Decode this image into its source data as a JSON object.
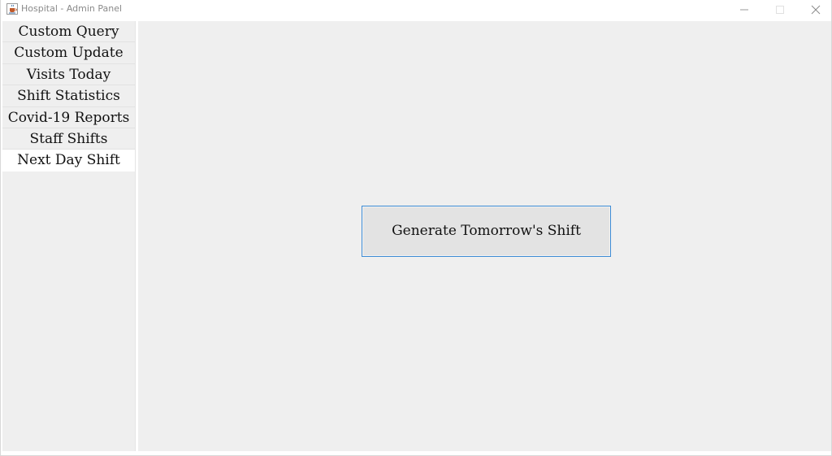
{
  "window": {
    "title": "Hospital - Admin Panel",
    "icon": "java-cup-icon",
    "controls": {
      "minimize": "minimize-icon",
      "maximize": "maximize-icon",
      "close": "close-icon"
    }
  },
  "sidebar": {
    "items": [
      {
        "label": "Custom Query",
        "selected": false
      },
      {
        "label": "Custom Update",
        "selected": false
      },
      {
        "label": "Visits Today",
        "selected": false
      },
      {
        "label": "Shift Statistics",
        "selected": false
      },
      {
        "label": "Covid-19 Reports",
        "selected": false
      },
      {
        "label": "Staff Shifts",
        "selected": false
      },
      {
        "label": "Next Day Shift",
        "selected": true
      }
    ]
  },
  "main": {
    "generate_button_label": "Generate Tomorrow's Shift"
  },
  "colors": {
    "panel_background": "#efefef",
    "selected_item_background": "#ffffff",
    "button_border_focus": "#3c8bd4",
    "button_background": "#e3e3e3"
  }
}
